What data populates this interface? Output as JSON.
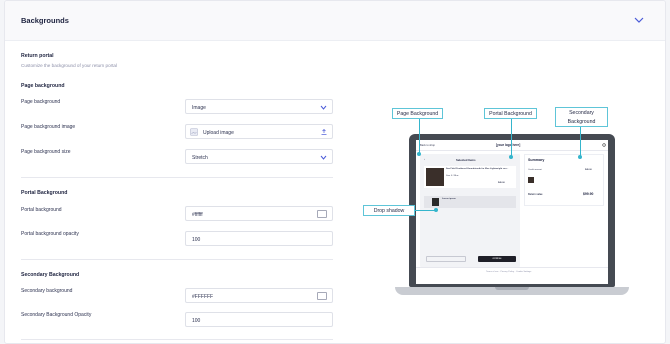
{
  "header": {
    "title": "Backgrounds",
    "collapse_icon": "chevron-up-icon"
  },
  "return_portal": {
    "title": "Return portal",
    "subtitle": "Customize the background of your return portal"
  },
  "page_background": {
    "title": "Page background",
    "rows": [
      {
        "label": "Page background",
        "value": "Image"
      },
      {
        "label": "Page background image",
        "value": "Upload image"
      },
      {
        "label": "Page background size",
        "value": "Stretch"
      }
    ]
  },
  "portal_background": {
    "title": "Portal Background",
    "rows": [
      {
        "label": "Portal background",
        "value": "#ffffff"
      },
      {
        "label": "Portal background opacity",
        "value": "100"
      }
    ]
  },
  "secondary_background": {
    "title": "Secondary Background",
    "rows": [
      {
        "label": "Secondary background",
        "value": "#FFFFFF"
      },
      {
        "label": "Secondary Background Opacity",
        "value": "100"
      }
    ]
  },
  "preview": {
    "callouts": {
      "page_background": "Page Background",
      "portal_background": "Portal Background",
      "secondary_background": "Secondary Background",
      "drop_shadow": "Drop shadow"
    },
    "screen": {
      "back_link": "Back to shop",
      "logo": "[your logo here]",
      "selected_items": "Selected Items",
      "item1_name": "Sea Field Feathered Houndstooth for Men Lightweight run...",
      "item1_meta": "Size S / Blue",
      "item1_price": "$45.00",
      "item2_name": "Lorem ipsum",
      "summary_title": "Summary",
      "summary_line1": "Credit amount",
      "summary_line1_val": "$45.00",
      "summary_total_label": "Return value",
      "summary_total_val": "$99.90",
      "continue_btn": "continue",
      "footer": "Terms of use · Privacy Policy · Cookie Settings"
    }
  },
  "colors": {
    "accent": "#35b5cc",
    "brand_dark": "#1f2440",
    "muted": "#8c8fa8"
  }
}
